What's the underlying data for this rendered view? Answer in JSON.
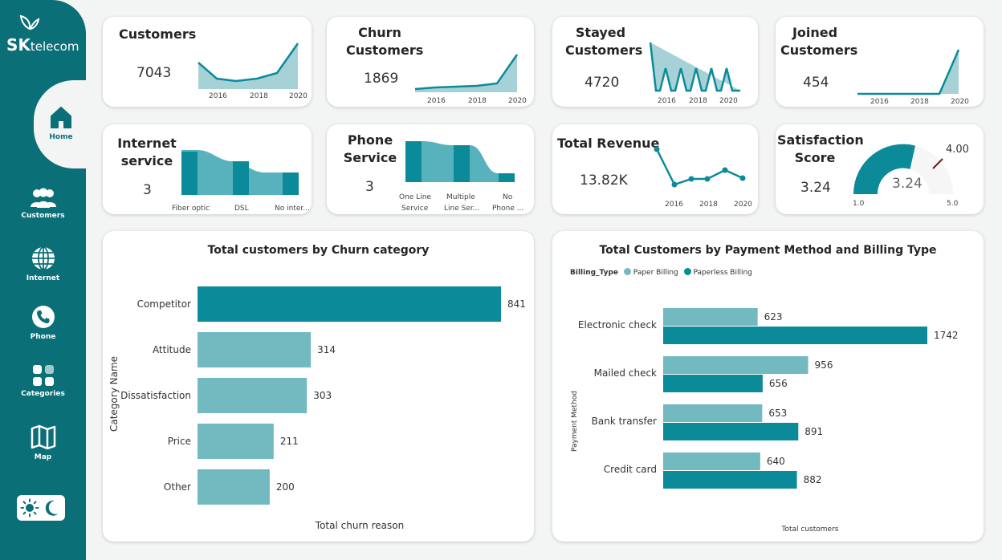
{
  "brand": {
    "sk": "SK",
    "telecom": "telecom"
  },
  "nav": [
    {
      "label": "Home",
      "icon": "home-icon"
    },
    {
      "label": "Customers",
      "icon": "customers-icon"
    },
    {
      "label": "Internet",
      "icon": "globe-icon"
    },
    {
      "label": "Phone",
      "icon": "phone-icon"
    },
    {
      "label": "Categories",
      "icon": "grid-icon"
    },
    {
      "label": "Map",
      "icon": "map-icon"
    }
  ],
  "colors": {
    "teal": "#0b8a99",
    "light_teal": "#72b9c0",
    "sidebar": "#0b6f78"
  },
  "kpis": {
    "customers": {
      "title": "Customers",
      "value": "7043",
      "ticks": [
        "2016",
        "2018",
        "2020"
      ]
    },
    "churn": {
      "title_1": "Churn",
      "title_2": "Customers",
      "value": "1869",
      "ticks": [
        "2016",
        "2018",
        "2020"
      ]
    },
    "stayed": {
      "title_1": "Stayed",
      "title_2": "Customers",
      "value": "4720",
      "ticks": [
        "2016",
        "2018",
        "2020"
      ]
    },
    "joined": {
      "title_1": "Joined",
      "title_2": "Customers",
      "value": "454",
      "ticks": [
        "2016",
        "2018",
        "2020"
      ]
    },
    "internet": {
      "title_1": "Internet",
      "title_2": "service",
      "value": "3",
      "ticks": [
        "Fiber optic",
        "DSL",
        "No inter..."
      ]
    },
    "phone": {
      "title_1": "Phone",
      "title_2": "Service",
      "value": "3",
      "ticks_1": [
        "One Line",
        "Multiple",
        "No"
      ],
      "ticks_2": [
        "Service",
        "Line Ser...",
        "Phone ..."
      ]
    },
    "revenue": {
      "title": "Total Revenue",
      "value": "13.82K",
      "ticks": [
        "2016",
        "2018",
        "2020"
      ]
    },
    "satisfaction": {
      "title_1": "Satisfaction",
      "title_2": "Score",
      "value": "3.24",
      "gauge_value": "3.24",
      "target": "4.00",
      "min": "1.0",
      "max": "5.0"
    }
  },
  "chart_data": [
    {
      "type": "bar",
      "title": "Total customers by Churn category",
      "xlabel": "Total churn reason",
      "ylabel": "Category Name",
      "categories": [
        "Competitor",
        "Attitude",
        "Dissatisfaction",
        "Price",
        "Other"
      ],
      "values": [
        841,
        314,
        303,
        211,
        200
      ]
    },
    {
      "type": "bar",
      "title": "Total Customers by Payment Method and Billing Type",
      "xlabel": "Total customers",
      "ylabel": "Payment Method",
      "legend_title": "Billing_Type",
      "legend_position": "top-left",
      "categories": [
        "Electronic check",
        "Mailed check",
        "Bank transfer",
        "Credit card"
      ],
      "series": [
        {
          "name": "Paper Billing",
          "values": [
            623,
            956,
            653,
            640
          ]
        },
        {
          "name": "Paperless Billing",
          "values": [
            1742,
            656,
            891,
            882
          ]
        }
      ]
    }
  ]
}
